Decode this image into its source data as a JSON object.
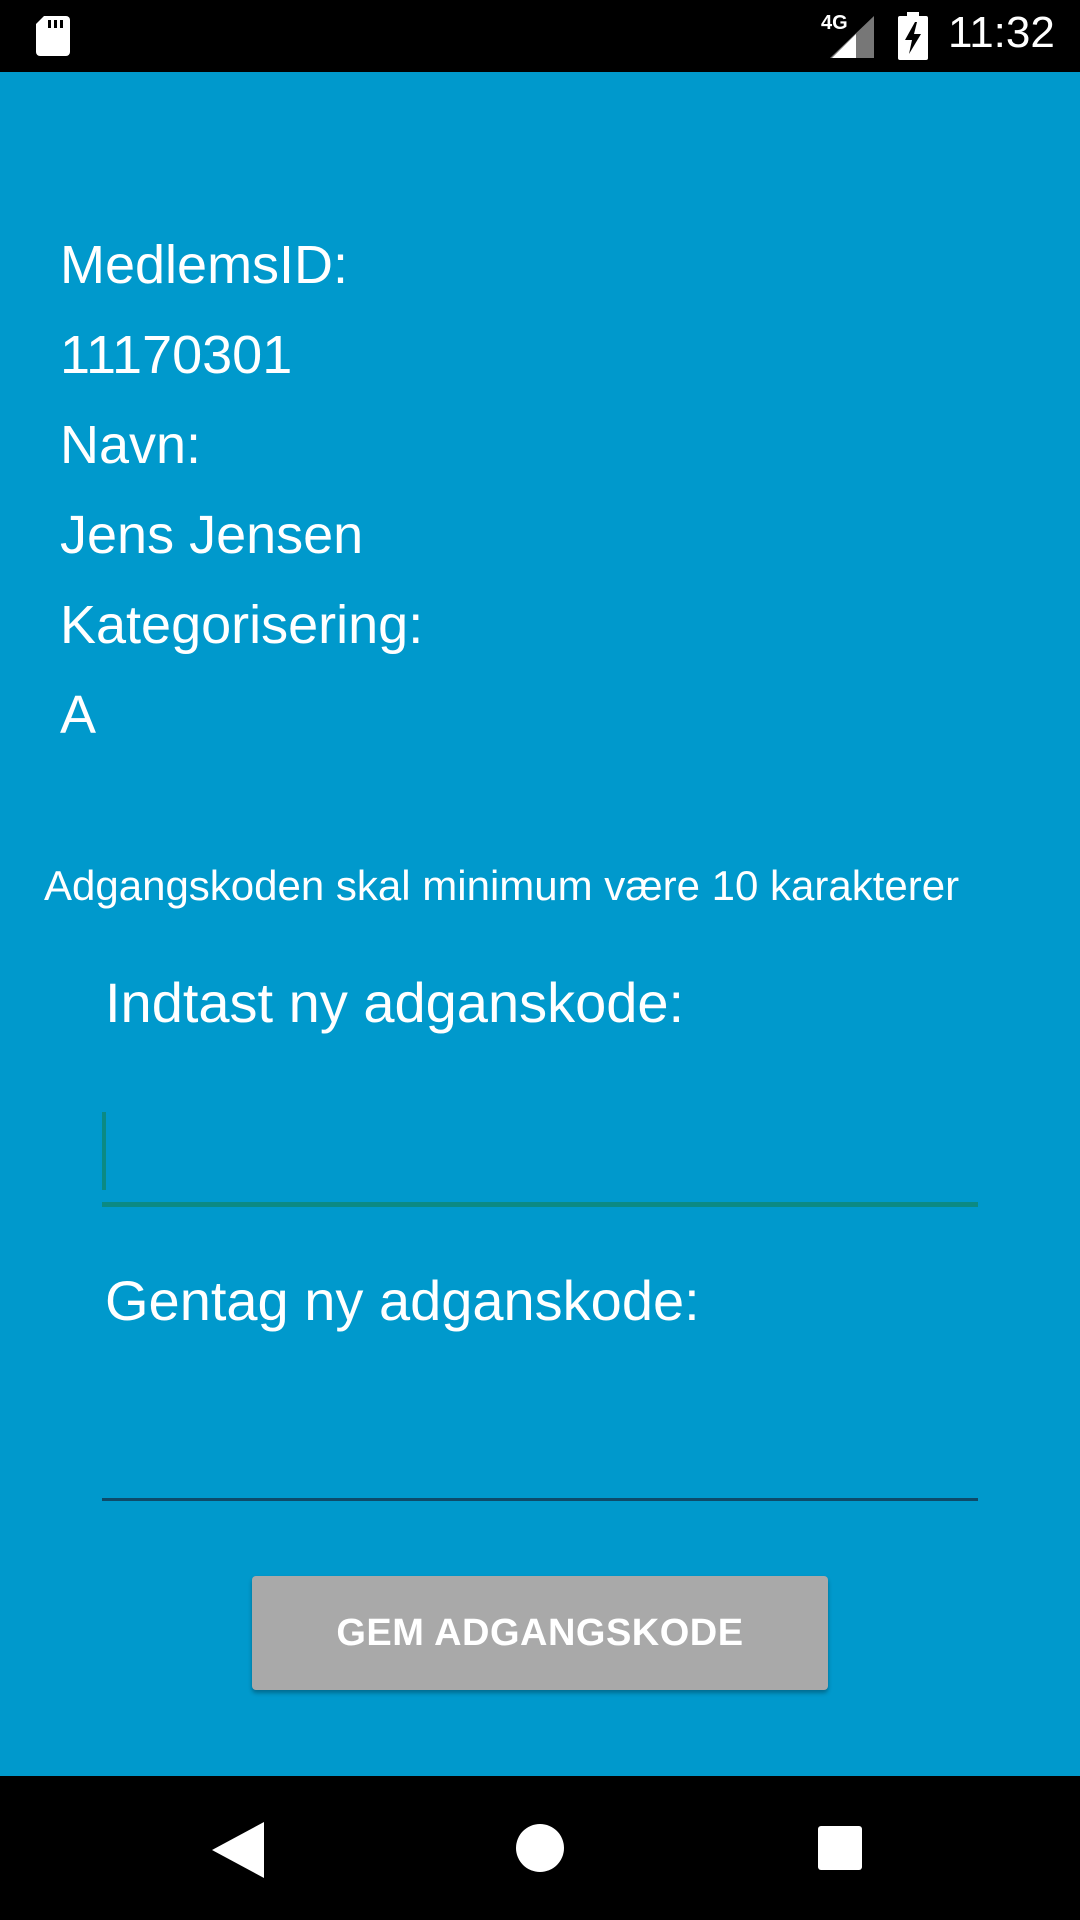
{
  "status_bar": {
    "network": "4G",
    "time": "11:32",
    "icons": [
      "sd-card-icon",
      "signal-icon",
      "battery-charging-icon"
    ]
  },
  "profile": {
    "member_id_label": "MedlemsID:",
    "member_id_value": "11170301",
    "name_label": "Navn:",
    "name_value": "Jens Jensen",
    "category_label": "Kategorisering:",
    "category_value": "A"
  },
  "password_form": {
    "hint": "Adgangskoden skal minimum være 10 karakterer",
    "new_label": "Indtast ny adganskode:",
    "new_value": "",
    "repeat_label": "Gentag ny adganskode:",
    "repeat_value": "",
    "save_label": "GEM ADGANGSKODE"
  },
  "navigation": {
    "icons": [
      "back-icon",
      "home-icon",
      "recents-icon"
    ]
  },
  "colors": {
    "background": "#0099cc",
    "accent": "#0b8a84",
    "button": "#a9a9a9",
    "bars": "#000000"
  }
}
